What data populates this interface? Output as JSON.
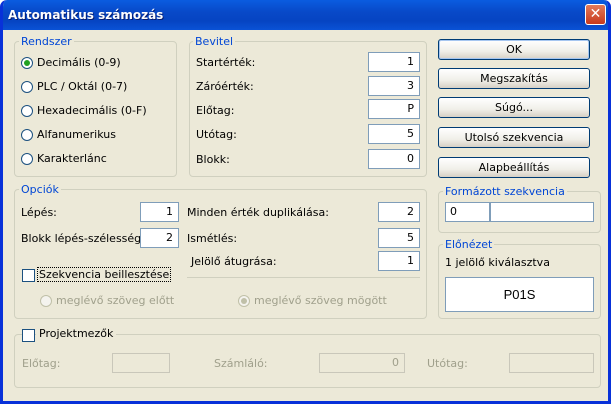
{
  "window": {
    "title": "Automatikus számozás",
    "close_glyph": "✕"
  },
  "rendszer": {
    "legend": "Rendszer",
    "options": [
      {
        "label": "Decimális (0-9)",
        "selected": true
      },
      {
        "label": "PLC / Oktál (0-7)",
        "selected": false
      },
      {
        "label": "Hexadecimális (0-F)",
        "selected": false
      },
      {
        "label": "Alfanumerikus",
        "selected": false
      },
      {
        "label": "Karakterlánc",
        "selected": false
      }
    ]
  },
  "bevitel": {
    "legend": "Bevitel",
    "fields": [
      {
        "label": "Startérték:",
        "value": "1"
      },
      {
        "label": "Záróérték:",
        "value": "3"
      },
      {
        "label": "Előtag:",
        "value": "P"
      },
      {
        "label": "Utótag:",
        "value": "5"
      },
      {
        "label": "Blokk:",
        "value": "0"
      }
    ]
  },
  "buttons": {
    "ok": "OK",
    "cancel": "Megszakítás",
    "help": "Súgó...",
    "last_sequence": "Utolsó szekvencia",
    "defaults": "Alapbeállítás"
  },
  "opciok": {
    "legend": "Opciók",
    "lepes_label": "Lépés:",
    "lepes_value": "1",
    "blokk_lepes_label": "Blokk lépés-szélesség:",
    "blokk_lepes_value": "2",
    "duplikalas_label": "Minden érték duplikálása:",
    "duplikalas_value": "2",
    "ismetles_label": "Ismétlés:",
    "ismetles_value": "5",
    "jelolo_label": "Jelölő átugrása:",
    "jelolo_value": "1",
    "beillesztes_label": "Szekvencia beillesztése",
    "beillesztes_checked": false,
    "before_label": "meglévő szöveg előtt",
    "after_label": "meglévő szöveg mögött"
  },
  "formazott": {
    "legend": "Formázott szekvencia",
    "value1": "0",
    "value2": ""
  },
  "elonezet": {
    "legend": "Előnézet",
    "info": "1 jelölő kiválasztva",
    "preview": "P01S"
  },
  "projekt": {
    "label": "Projektmezők",
    "checked": false,
    "elotag_label": "Előtag:",
    "elotag_value": "",
    "szamlalo_label": "Számláló:",
    "szamlalo_value": "0",
    "utotag_label": "Utótag:",
    "utotag_value": ""
  }
}
